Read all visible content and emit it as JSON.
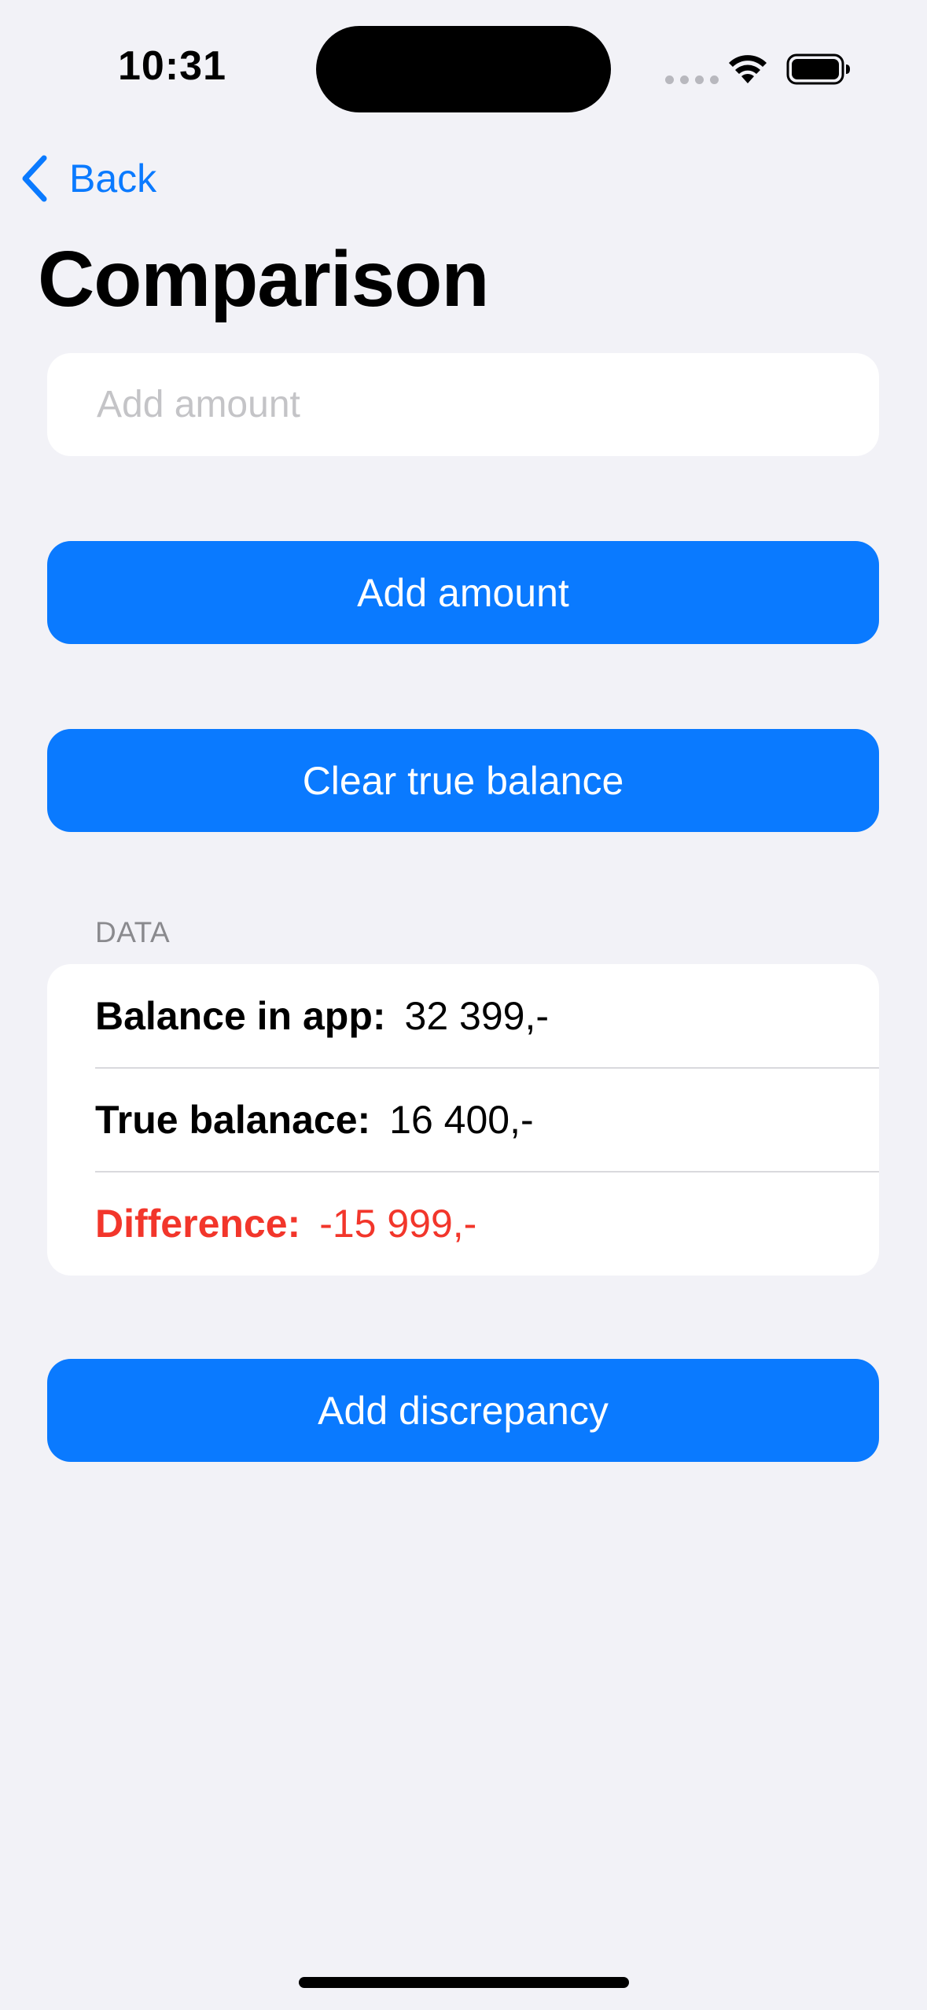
{
  "status_bar": {
    "time": "10:31"
  },
  "nav": {
    "back_label": "Back",
    "title": "Comparison"
  },
  "amount_input": {
    "placeholder": "Add amount",
    "value": ""
  },
  "buttons": {
    "add_amount": "Add amount",
    "clear_true_balance": "Clear true balance",
    "add_discrepancy": "Add discrepancy"
  },
  "data_section": {
    "header": "DATA",
    "rows": [
      {
        "label": "Balance in app:",
        "value": "32 399,-"
      },
      {
        "label": "True balanace:",
        "value": "16 400,-"
      },
      {
        "label": "Difference:",
        "value": "-15 999,-"
      }
    ]
  },
  "colors": {
    "accent": "#0A7AFF",
    "background": "#F2F2F7",
    "negative": "#F2362B"
  },
  "icons": {
    "back": "chevron-left-icon",
    "wifi": "wifi-icon",
    "battery": "battery-icon",
    "signal": "cellular-signal-icon"
  }
}
